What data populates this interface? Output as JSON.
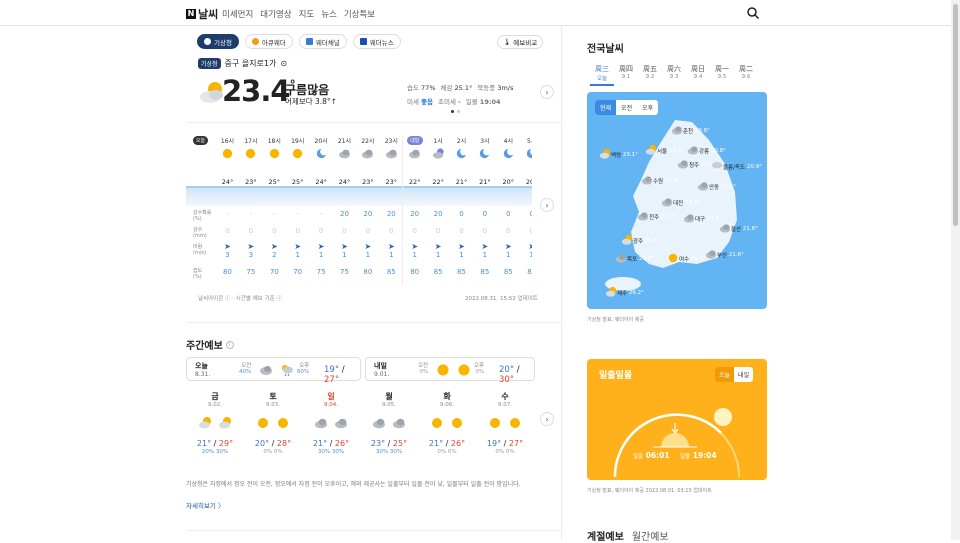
{
  "header": {
    "logo_letter": "N",
    "logo_text": "날씨",
    "nav": [
      "미세먼지",
      "대기영상",
      "지도",
      "뉴스",
      "기상특보"
    ]
  },
  "source_tabs": [
    {
      "label": "기상청",
      "active": true,
      "color": "#ffffff"
    },
    {
      "label": "아큐웨더",
      "active": false,
      "color": "#f39c12"
    },
    {
      "label": "웨더채널",
      "active": false,
      "color": "#3a7ad6"
    },
    {
      "label": "웨더뉴스",
      "active": false,
      "color": "#1f4fae"
    }
  ],
  "compare_label": "예보비교",
  "location": {
    "badge": "기상청",
    "name": "중구 을지로1가"
  },
  "current": {
    "temp": "23.4",
    "unit": "°",
    "condition": "구름많음",
    "compare": "어제보다 3.8°↑",
    "humidity_label": "습도",
    "humidity": "77%",
    "feels_label": "체감",
    "feels": "25.1°",
    "wind_label": "북동풍",
    "wind": "3m/s",
    "dust_label": "미세",
    "dust": "좋음",
    "fine_label": "초미세",
    "fine": "-",
    "sunset_label": "일몰",
    "sunset": "19:04"
  },
  "hourly": {
    "row_labels": [
      {
        "l1": "강수확률",
        "l2": "(%)"
      },
      {
        "l1": "강수",
        "l2": "(mm)"
      },
      {
        "l1": "바람",
        "l2": "(m/s)"
      },
      {
        "l1": "습도",
        "l2": "(%)"
      }
    ],
    "today_badge": "오늘",
    "tomorrow_badge": "내일",
    "hours": [
      {
        "label": "16시",
        "icon": "sun-icon",
        "temp": "24°",
        "pop": "-",
        "rain": "0",
        "wind": "3",
        "hum": "80"
      },
      {
        "label": "17시",
        "icon": "sun-icon",
        "temp": "23°",
        "pop": "-",
        "rain": "0",
        "wind": "3",
        "hum": "75"
      },
      {
        "label": "18시",
        "icon": "sun-icon",
        "temp": "25°",
        "pop": "-",
        "rain": "0",
        "wind": "2",
        "hum": "70"
      },
      {
        "label": "19시",
        "icon": "sun-icon",
        "temp": "25°",
        "pop": "-",
        "rain": "0",
        "wind": "1",
        "hum": "70"
      },
      {
        "label": "20시",
        "icon": "moon-icon",
        "temp": "24°",
        "pop": "-",
        "rain": "0",
        "wind": "1",
        "hum": "75"
      },
      {
        "label": "21시",
        "icon": "cloud-icon",
        "temp": "24°",
        "pop": "20",
        "rain": "0",
        "wind": "1",
        "hum": "75"
      },
      {
        "label": "22시",
        "icon": "cloud-icon",
        "temp": "23°",
        "pop": "20",
        "rain": "0",
        "wind": "1",
        "hum": "80"
      },
      {
        "label": "23시",
        "icon": "cloud-icon",
        "temp": "23°",
        "pop": "20",
        "rain": "0",
        "wind": "1",
        "hum": "85"
      },
      {
        "label": "내일",
        "icon": "cloud-icon",
        "temp": "22°",
        "pop": "20",
        "rain": "0",
        "wind": "1",
        "hum": "80"
      },
      {
        "label": "1시",
        "icon": "cloud-moon-icon",
        "temp": "22°",
        "pop": "20",
        "rain": "0",
        "wind": "1",
        "hum": "85"
      },
      {
        "label": "2시",
        "icon": "moon-icon",
        "temp": "21°",
        "pop": "0",
        "rain": "0",
        "wind": "1",
        "hum": "85"
      },
      {
        "label": "3시",
        "icon": "moon-icon",
        "temp": "21°",
        "pop": "0",
        "rain": "0",
        "wind": "1",
        "hum": "85"
      },
      {
        "label": "4시",
        "icon": "moon-icon",
        "temp": "20°",
        "pop": "0",
        "rain": "0",
        "wind": "1",
        "hum": "85"
      },
      {
        "label": "5시",
        "icon": "moon-icon",
        "temp": "20°",
        "pop": "0",
        "rain": "0",
        "wind": "1",
        "hum": "85"
      }
    ],
    "footer_left": "날씨아이콘 ⓘ · 시간별 예보 기준 ⓘ",
    "updated": "2022.08.31. 15:52 업데이트"
  },
  "weekly": {
    "title": "주간예보",
    "today": {
      "name": "오늘",
      "date": "8.31.",
      "am": "오전",
      "am_pct": "40%",
      "pm": "오후",
      "pm_pct": "60%",
      "lo": "19°",
      "hi": "27°"
    },
    "tomorrow": {
      "name": "내일",
      "date": "9.01.",
      "am": "오전",
      "am_pct": "0%",
      "pm": "오후",
      "pm_pct": "0%",
      "lo": "20°",
      "hi": "30°"
    },
    "days": [
      {
        "day": "금",
        "date": "9.02.",
        "red": false,
        "lo": "21°",
        "hi": "29°",
        "r1": "20%",
        "r2": "30%",
        "i1": "sun-cloud-icon",
        "i2": "sun-cloud-icon"
      },
      {
        "day": "토",
        "date": "9.03.",
        "red": false,
        "lo": "20°",
        "hi": "28°",
        "r1": "0%",
        "r2": "0%",
        "i1": "sun-icon",
        "i2": "sun-icon"
      },
      {
        "day": "일",
        "date": "9.04.",
        "red": true,
        "lo": "21°",
        "hi": "26°",
        "r1": "30%",
        "r2": "30%",
        "i1": "cloud-icon",
        "i2": "cloud-icon"
      },
      {
        "day": "월",
        "date": "9.05.",
        "red": false,
        "lo": "23°",
        "hi": "25°",
        "r1": "30%",
        "r2": "30%",
        "i1": "cloud-icon",
        "i2": "cloud-icon"
      },
      {
        "day": "화",
        "date": "9.06.",
        "red": false,
        "lo": "21°",
        "hi": "26°",
        "r1": "0%",
        "r2": "0%",
        "i1": "sun-icon",
        "i2": "sun-icon"
      },
      {
        "day": "수",
        "date": "9.07.",
        "red": false,
        "lo": "19°",
        "hi": "27°",
        "r1": "0%",
        "r2": "0%",
        "i1": "sun-icon",
        "i2": "sun-icon"
      }
    ],
    "note": "기상청은 자정에서 정오 전이 오전, 정오에서 자정 전이 오후이고, 해외 제공사는 일출부터 일몰 전이 낮, 일몰부터 일출 전이 밤입니다.",
    "more": "자세히보기 〉"
  },
  "national": {
    "title": "전국날씨",
    "days": [
      {
        "w": "周三",
        "d": "오늘",
        "sel": true
      },
      {
        "w": "周四",
        "d": "9.1",
        "sel": false
      },
      {
        "w": "周五",
        "d": "9.2",
        "sel": false
      },
      {
        "w": "周六",
        "d": "9.3",
        "sel": false
      },
      {
        "w": "周日",
        "d": "9.4",
        "sel": false
      },
      {
        "w": "周一",
        "d": "9.5",
        "sel": false
      },
      {
        "w": "周二",
        "d": "9.6",
        "sel": false
      }
    ],
    "map_tabs": [
      "현재",
      "오전",
      "오후"
    ],
    "cities": [
      {
        "name": "춘천",
        "temp": "23.8°",
        "icon": "cloud-icon"
      },
      {
        "name": "서울",
        "temp": "23.4°",
        "icon": "sun-cloud-icon"
      },
      {
        "name": "강릉",
        "temp": "20.8°",
        "icon": "cloud-icon"
      },
      {
        "name": "백령",
        "temp": "23.1°",
        "icon": "sun-cloud-icon"
      },
      {
        "name": "청주",
        "temp": "20.9°",
        "icon": "cloud-icon"
      },
      {
        "name": "울릉/독도",
        "temp": "20.9°",
        "icon": "rain-icon"
      },
      {
        "name": "수원",
        "temp": "22.8°",
        "icon": "cloud-icon"
      },
      {
        "name": "안동",
        "temp": "22.5°",
        "icon": "cloud-icon"
      },
      {
        "name": "대전",
        "temp": "22.3°",
        "icon": "cloud-icon"
      },
      {
        "name": "전주",
        "temp": "23.8°",
        "icon": "cloud-icon"
      },
      {
        "name": "대구",
        "temp": "22.3°",
        "icon": "cloud-icon"
      },
      {
        "name": "울산",
        "temp": "21.6°",
        "icon": "cloud-icon"
      },
      {
        "name": "광주",
        "temp": "25.5°",
        "icon": "sun-cloud-icon"
      },
      {
        "name": "부산",
        "temp": "21.6°",
        "icon": "cloud-icon"
      },
      {
        "name": "목포",
        "temp": "25.1°",
        "icon": "cloud-icon"
      },
      {
        "name": "여수",
        "temp": "25.9°",
        "icon": "sun-icon"
      },
      {
        "name": "제주",
        "temp": "26.2°",
        "icon": "sun-cloud-icon"
      }
    ],
    "source": "기상청 발표, 웨더아이 제공"
  },
  "sun": {
    "title": "일출일몰",
    "tabs": [
      "오늘",
      "내일"
    ],
    "sunrise_label": "일출",
    "sunrise": "06:01",
    "sunset_label": "일몰",
    "sunset": "19:04",
    "source": "기상청 발표, 웨더아이 제공 2022.08.01. 03:15 업데이트"
  },
  "season": {
    "tab1": "계절예보",
    "tab2": "월간예보"
  }
}
